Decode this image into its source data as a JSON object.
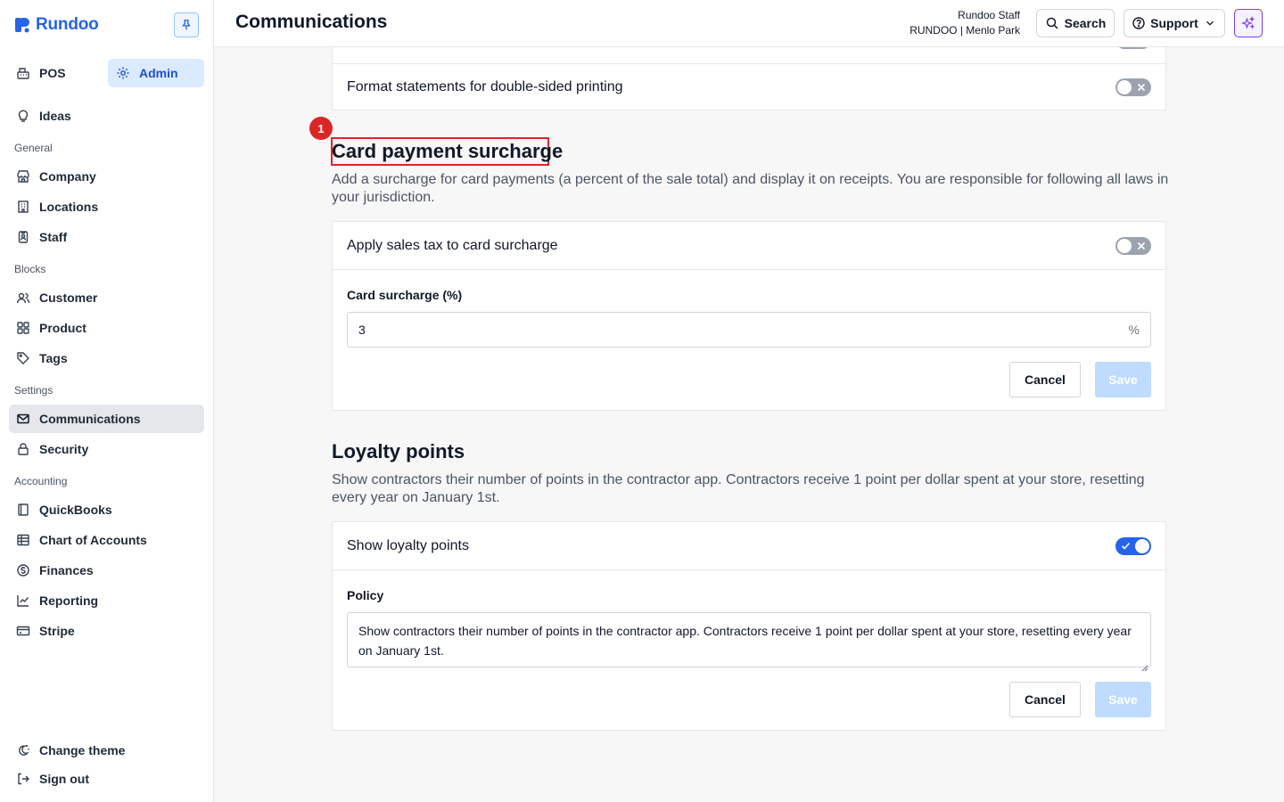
{
  "brand": {
    "name": "Rundoo",
    "accent": "#2563eb"
  },
  "sidebar": {
    "modes": [
      {
        "label": "POS",
        "icon": "cash-register-icon"
      },
      {
        "label": "Admin",
        "icon": "gear-icon",
        "active": true
      }
    ],
    "ideas": {
      "label": "Ideas",
      "icon": "lightbulb-icon"
    },
    "sections": [
      {
        "title": "General",
        "items": [
          {
            "label": "Company",
            "icon": "storefront-icon"
          },
          {
            "label": "Locations",
            "icon": "building-icon"
          },
          {
            "label": "Staff",
            "icon": "id-badge-icon"
          }
        ]
      },
      {
        "title": "Blocks",
        "items": [
          {
            "label": "Customer",
            "icon": "users-icon"
          },
          {
            "label": "Product",
            "icon": "grid-icon"
          },
          {
            "label": "Tags",
            "icon": "tag-icon"
          }
        ]
      },
      {
        "title": "Settings",
        "items": [
          {
            "label": "Communications",
            "icon": "mail-icon",
            "active": true
          },
          {
            "label": "Security",
            "icon": "lock-icon"
          }
        ]
      },
      {
        "title": "Accounting",
        "items": [
          {
            "label": "QuickBooks",
            "icon": "book-icon"
          },
          {
            "label": "Chart of Accounts",
            "icon": "table-icon"
          },
          {
            "label": "Finances",
            "icon": "dollar-circle-icon"
          },
          {
            "label": "Reporting",
            "icon": "line-chart-icon"
          },
          {
            "label": "Stripe",
            "icon": "credit-card-icon"
          }
        ]
      }
    ],
    "footer": [
      {
        "label": "Change theme",
        "icon": "theme-icon"
      },
      {
        "label": "Sign out",
        "icon": "sign-out-icon"
      }
    ]
  },
  "header": {
    "title": "Communications",
    "user_name": "Rundoo Staff",
    "store": "RUNDOO | Menlo Park",
    "search_label": "Search",
    "support_label": "Support"
  },
  "statements": {
    "double_sided_label": "Format statements for double-sided printing",
    "double_sided_on": false
  },
  "surcharge": {
    "badge": "1",
    "title": "Card payment surcharge",
    "description": "Add a surcharge for card payments (a percent of the sale total) and display it on receipts. You are responsible for following all laws in your jurisdiction.",
    "apply_tax_label": "Apply sales tax to card surcharge",
    "apply_tax_on": false,
    "field_label": "Card surcharge (%)",
    "field_value": "3",
    "field_suffix": "%",
    "cancel_label": "Cancel",
    "save_label": "Save"
  },
  "loyalty": {
    "title": "Loyalty points",
    "description": "Show contractors their number of points in the contractor app. Contractors receive 1 point per dollar spent at your store, resetting every year on January 1st.",
    "show_label": "Show loyalty points",
    "show_on": true,
    "policy_label": "Policy",
    "policy_value": "Show contractors their number of points in the contractor app. Contractors receive 1 point per dollar spent at your store, resetting every year on January 1st.",
    "cancel_label": "Cancel",
    "save_label": "Save"
  }
}
